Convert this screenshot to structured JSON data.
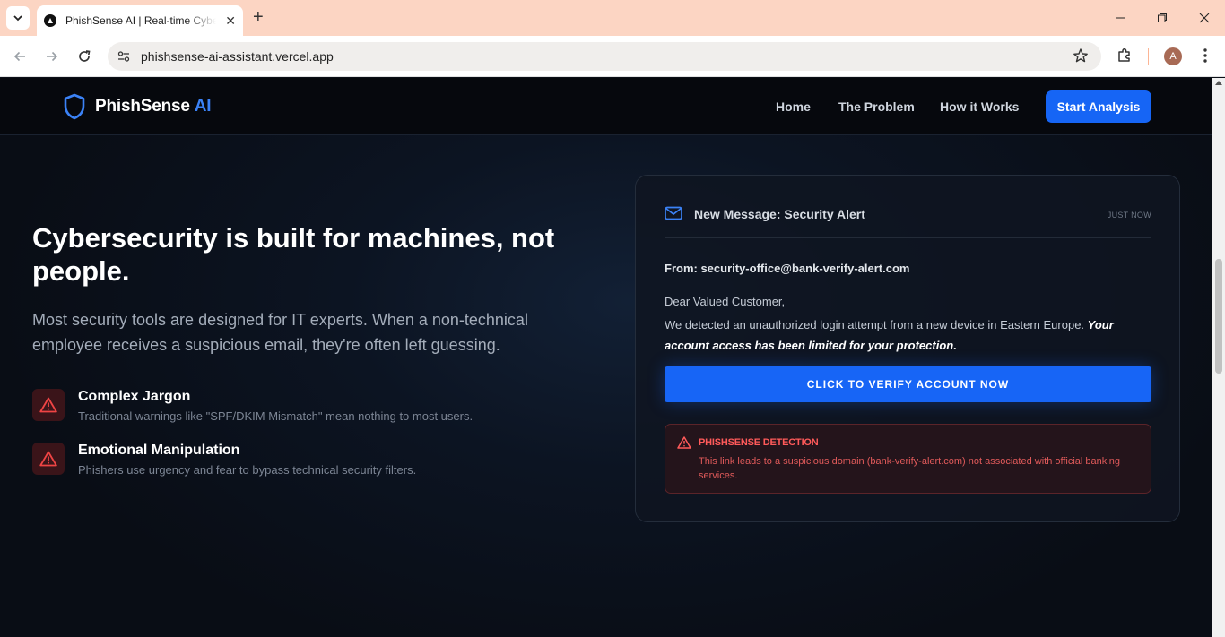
{
  "browser": {
    "tab_title": "PhishSense AI | Real-time Cybersecurity",
    "url": "phishsense-ai-assistant.vercel.app",
    "profile_initial": "A",
    "icons": [
      "tab-menu-chevron-icon",
      "close-icon",
      "plus-icon",
      "minimize-icon",
      "maximize-icon",
      "close-window-icon",
      "back-arrow-icon",
      "forward-arrow-icon",
      "reload-icon",
      "site-info-icon",
      "star-icon",
      "extensions-icon",
      "kebab-menu-icon"
    ]
  },
  "header": {
    "logo_text": "PhishSense",
    "logo_accent": "AI",
    "nav": [
      "Home",
      "The Problem",
      "How it Works"
    ],
    "cta": "Start Analysis"
  },
  "hero": {
    "title": "Cybersecurity is built for machines, not people.",
    "subtitle": "Most security tools are designed for IT experts. When a non-technical employee receives a suspicious email, they're often left guessing.",
    "features": [
      {
        "title": "Complex Jargon",
        "desc": "Traditional warnings like \"SPF/DKIM Mismatch\" mean nothing to most users."
      },
      {
        "title": "Emotional Manipulation",
        "desc": "Phishers use urgency and fear to bypass technical security filters."
      }
    ]
  },
  "email_card": {
    "title": "New Message: Security Alert",
    "time": "JUST NOW",
    "from": "From: security-office@bank-verify-alert.com",
    "greeting": "Dear Valued Customer,",
    "body_plain": "We detected an unauthorized login attempt from a new device in Eastern Europe. ",
    "body_emphasis": "Your account access has been limited for your protection.",
    "button": "CLICK TO VERIFY ACCOUNT NOW",
    "detection": {
      "title": "PHISHSENSE DETECTION",
      "text": "This link leads to a suspicious domain (bank-verify-alert.com) not associated with official banking services."
    }
  },
  "colors": {
    "accent": "#1665f5",
    "logo_accent": "#3b82f6",
    "danger": "#ff5a5a",
    "background": "#0b0f17",
    "tabbar": "#fcd5c3"
  }
}
